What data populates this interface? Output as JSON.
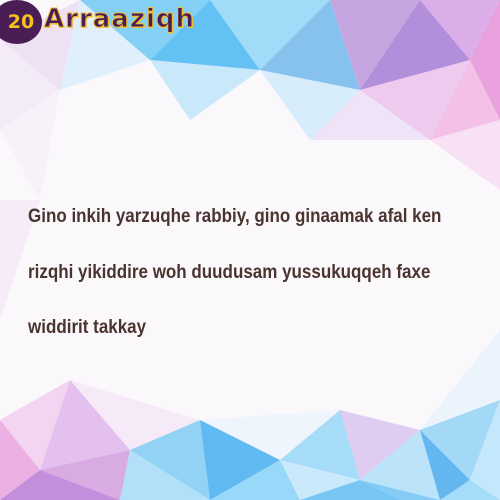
{
  "header": {
    "badge_number": "20",
    "brand_name": "Arraaziqh"
  },
  "message": {
    "lines": [
      "Gino inkih yarzuqhe rabbiy, gino ginaamak afal ken",
      "rizqhi yikiddire woh duudusam yussukuqqeh faxe",
      "widdirit takkay"
    ]
  },
  "colors": {
    "badge_bg": "#4a1d55",
    "badge_text": "#f4c21a",
    "text": "#4a3430",
    "accent_blue": "#3fb3f0",
    "accent_pink": "#e58ad6"
  }
}
